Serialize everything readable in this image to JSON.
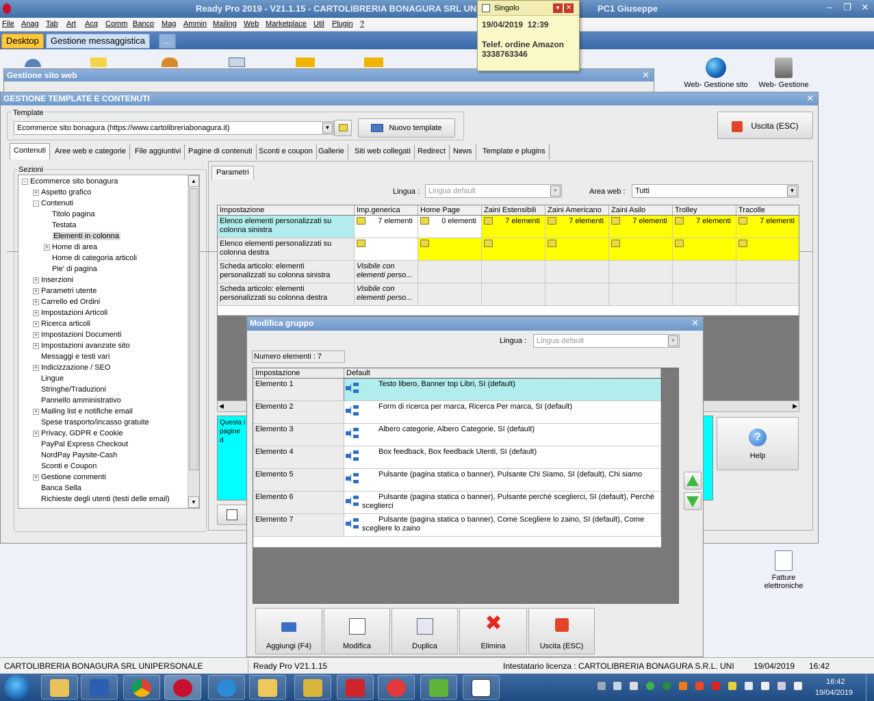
{
  "app": {
    "title": "Ready Pro 2019 - V21.1.15 - CARTOLIBRERIA BONAGURA SRL UNIPERSONALE - Giuseppe PC1 Giuseppe",
    "title_short": "Ready Pro 2019 - V21.1.15 - CARTOLIBRERIA BONAGURA SRL UNI",
    "title_tail": "PC1 Giuseppe"
  },
  "menu": [
    "File",
    "Anag",
    "Tab",
    "Art",
    "Acq",
    "Comm",
    "Banco",
    "Mag",
    "Ammin",
    "Mailing",
    "Web",
    "Marketplace",
    "Util",
    "Plugin",
    "?"
  ],
  "doc_tabs": [
    "Desktop",
    "Gestione messaggistica",
    "..."
  ],
  "desktop_icons": {
    "web_gestione_sito": "Web- Gestione sito",
    "web_gestione": "Web- Gestione",
    "fatture_line1": "Fatture",
    "fatture_line2": "elettroniche"
  },
  "popup": {
    "title": "Singolo",
    "date": "19/04/2019",
    "time": "12:39",
    "line1": "Telef. ordine Amazon",
    "line2": "3338763346"
  },
  "sito_web": {
    "title": "Gestione sito web"
  },
  "gestione": {
    "title": "GESTIONE TEMPLATE E CONTENUTI",
    "template_label": "Template",
    "template_value": "Ecommerce sito bonagura (https://www.cartolibreriabonagura.it)",
    "nuovo_template": "Nuovo template",
    "uscita": "Uscita (ESC)",
    "help": "Help",
    "tabs": [
      "Contenuti",
      "Aree web e categorie",
      "File aggiuntivi",
      "Pagine di contenuti",
      "Sconti e coupon",
      "Gallerie",
      "Siti web collegati",
      "Redirect",
      "News",
      "Template e plugins"
    ],
    "sezioni_label": "Sezioni",
    "tree": [
      {
        "label": "Ecommerce sito bonagura",
        "level": 0,
        "exp": "-"
      },
      {
        "label": "Aspetto grafico",
        "level": 1,
        "exp": "+"
      },
      {
        "label": "Contenuti",
        "level": 1,
        "exp": "-"
      },
      {
        "label": "Titolo pagina",
        "level": 2,
        "exp": ""
      },
      {
        "label": "Testata",
        "level": 2,
        "exp": ""
      },
      {
        "label": "Elementi in colonna",
        "level": 2,
        "exp": ""
      },
      {
        "label": "Home di area",
        "level": 2,
        "exp": "+"
      },
      {
        "label": "Home di categoria articoli",
        "level": 2,
        "exp": ""
      },
      {
        "label": "Pie' di pagina",
        "level": 2,
        "exp": ""
      },
      {
        "label": "Inserzioni",
        "level": 1,
        "exp": "+"
      },
      {
        "label": "Parametri utente",
        "level": 1,
        "exp": "+"
      },
      {
        "label": "Carrello ed Ordini",
        "level": 1,
        "exp": "+"
      },
      {
        "label": "Impostazioni Articoli",
        "level": 1,
        "exp": "+"
      },
      {
        "label": "Ricerca articoli",
        "level": 1,
        "exp": "+"
      },
      {
        "label": "Impostazioni Documenti",
        "level": 1,
        "exp": "+"
      },
      {
        "label": "Impostazioni avanzate sito",
        "level": 1,
        "exp": "+"
      },
      {
        "label": "Messaggi e testi vari",
        "level": 1,
        "exp": ""
      },
      {
        "label": "Indicizzazione / SEO",
        "level": 1,
        "exp": "+"
      },
      {
        "label": "Lingue",
        "level": 1,
        "exp": ""
      },
      {
        "label": "Stringhe/Traduzioni",
        "level": 1,
        "exp": ""
      },
      {
        "label": "Pannello amministrativo",
        "level": 1,
        "exp": ""
      },
      {
        "label": "Mailing list e notifiche email",
        "level": 1,
        "exp": "+"
      },
      {
        "label": "Spese trasporto/incasso gratuite",
        "level": 1,
        "exp": ""
      },
      {
        "label": "Privacy, GDPR e Cookie",
        "level": 1,
        "exp": "+"
      },
      {
        "label": "PayPal Express Checkout",
        "level": 1,
        "exp": ""
      },
      {
        "label": "NordPay Paysite-Cash",
        "level": 1,
        "exp": ""
      },
      {
        "label": "Sconti e Coupon",
        "level": 1,
        "exp": ""
      },
      {
        "label": "Gestione commenti",
        "level": 1,
        "exp": "+"
      },
      {
        "label": "Banca Sella",
        "level": 1,
        "exp": ""
      },
      {
        "label": "Richieste degli utenti (testi delle email)",
        "level": 1,
        "exp": ""
      }
    ],
    "parametri_tab": "Parametri",
    "lingua_label": "Lingua :",
    "lingua_value": "Lingua default",
    "area_label": "Area web :",
    "area_value": "Tutti",
    "grid_headers": [
      "Impostazione",
      "Imp.generica",
      "Home  Page",
      "Zaini  Estensibili",
      "Zaini  Americano",
      "Zaini  Asilo",
      "Trolley",
      "Tracolle"
    ],
    "grid_rows": [
      {
        "name": "Elenco elementi personalizzati su colonna sinistra",
        "cells": [
          "7 elementi",
          "0 elementi",
          "7 elementi",
          "7 elementi",
          "7 elementi",
          "7 elementi",
          "7 elementi"
        ]
      },
      {
        "name": "Elenco elementi personalizzati su colonna destra",
        "cells": [
          "",
          "",
          "",
          "",
          "",
          "",
          ""
        ]
      },
      {
        "name": "Scheda articolo: elementi personalizzati su colonna sinistra",
        "cells": [
          "Visibile con elementi perso...",
          "",
          "",
          "",
          "",
          "",
          ""
        ]
      },
      {
        "name": "Scheda articolo: elementi personalizzati su colonna destra",
        "cells": [
          "Visibile con elementi perso...",
          "",
          "",
          "",
          "",
          "",
          ""
        ]
      }
    ],
    "desc_text": "Questa i pagine d"
  },
  "modifica": {
    "title": "Modifica gruppo",
    "lingua_label": "Lingua :",
    "lingua_value": "Lingua default",
    "numero": "Numero elementi : 7",
    "headers": [
      "Impostazione",
      "Default"
    ],
    "rows": [
      {
        "name": "Elemento 1",
        "value": "Testo libero, Banner top Libri, SI (default)",
        "value2": ""
      },
      {
        "name": "Elemento 2",
        "value": "Form di ricerca per marca, Ricerca Per marca, SI (default)",
        "value2": ""
      },
      {
        "name": "Elemento 3",
        "value": "Albero categorie, Albero Categorie, SI (default)",
        "value2": ""
      },
      {
        "name": "Elemento 4",
        "value": "Box feedback, Box feedback Utenti, SI (default)",
        "value2": ""
      },
      {
        "name": "Elemento 5",
        "value": "Pulsante (pagina statica o banner), Pulsante Chi Siamo, SI (default), Chi siamo",
        "value2": ""
      },
      {
        "name": "Elemento 6",
        "value": "Pulsante (pagina statica o banner), Pulsante perchè sceglierci, SI (default), Perchè",
        "value2": "sceglierci"
      },
      {
        "name": "Elemento 7",
        "value": "Pulsante (pagina statica o banner), Come Scegliere lo zaino, SI (default), Come",
        "value2": "scegliere lo zaino"
      }
    ],
    "buttons": [
      "Aggiungi (F4)",
      "Modifica",
      "Duplica",
      "Elimina",
      "Uscita (ESC)"
    ]
  },
  "status": {
    "company": "CARTOLIBRERIA BONAGURA SRL UNIPERSONALE",
    "version": "Ready Pro V21.1.15",
    "licenza": "Intestatario licenza : CARTOLIBRERIA BONAGURA S.R.L. UNI",
    "date": "19/04/2019",
    "time": "16:42"
  },
  "taskbar": {
    "clock_time": "16:42",
    "clock_date": "19/04/2019"
  },
  "colors": {
    "selected_row": "#b3ecec",
    "yellow": "#ffff00",
    "cyan": "#00ffff",
    "title_blue": "#6f98ca"
  }
}
